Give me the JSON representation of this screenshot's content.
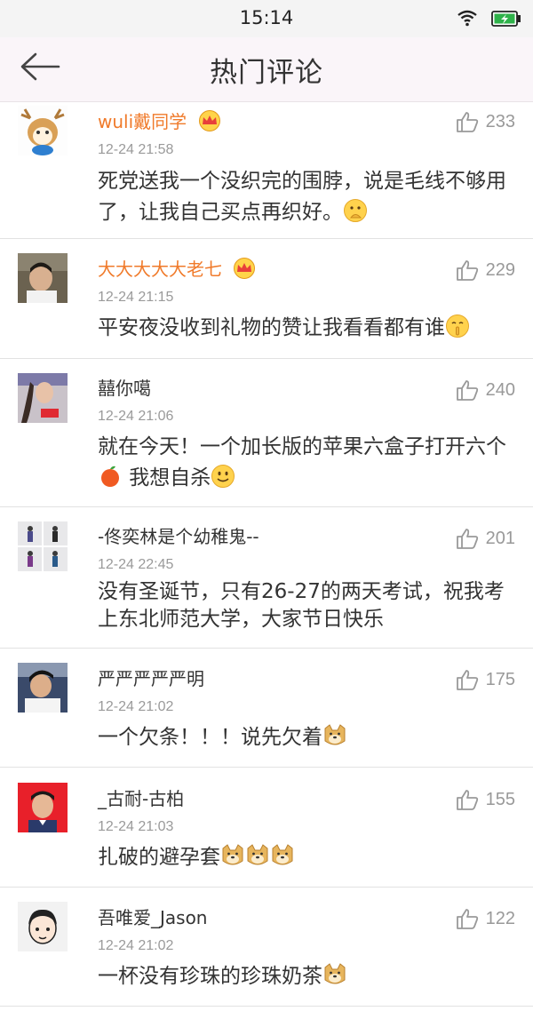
{
  "status_bar": {
    "time": "15:14",
    "battery_color": "#2fb24a"
  },
  "header": {
    "title": "热门评论",
    "back_icon": "back-arrow-icon"
  },
  "comments": [
    {
      "name": "wuli戴同学",
      "vip": true,
      "time": "12-24 21:58",
      "likes": "233",
      "text": "死党送我一个没织完的围脖，说是毛线不够用了，让我自己买点再织好。",
      "emoji": "thinking-emoji-icon"
    },
    {
      "name": "大大大大大老七",
      "vip": true,
      "time": "12-24 21:15",
      "likes": "229",
      "text": "平安夜没收到礼物的赞让我看看都有谁",
      "emoji": "shush-emoji-icon"
    },
    {
      "name": "囍你噶",
      "vip": false,
      "time": "12-24 21:06",
      "likes": "240",
      "text_a": "就在今天！一个加长版的苹果六盒子打开六个",
      "text_b": " 我想自杀",
      "emoji_a": "apple-icon",
      "emoji": "smile-emoji-icon"
    },
    {
      "name": "-佟奕林是个幼稚鬼--",
      "vip": false,
      "time": "12-24 22:45",
      "likes": "201",
      "text": "没有圣诞节，只有26-27的两天考试，祝我考上东北师范大学，大家节日快乐"
    },
    {
      "name": "严严严严严明",
      "vip": false,
      "time": "12-24 21:02",
      "likes": "175",
      "text": "一个欠条！！！说先欠着",
      "emoji": "doge-emoji-icon"
    },
    {
      "name": "_古耐-古柏",
      "vip": false,
      "time": "12-24 21:03",
      "likes": "155",
      "text": "扎破的避孕套",
      "emoji": "doge-emoji-icon"
    },
    {
      "name": "吾唯爱_Jason",
      "vip": false,
      "time": "12-24 21:02",
      "likes": "122",
      "text": "一杯没有珍珠的珍珠奶茶",
      "emoji": "doge-emoji-icon"
    }
  ]
}
